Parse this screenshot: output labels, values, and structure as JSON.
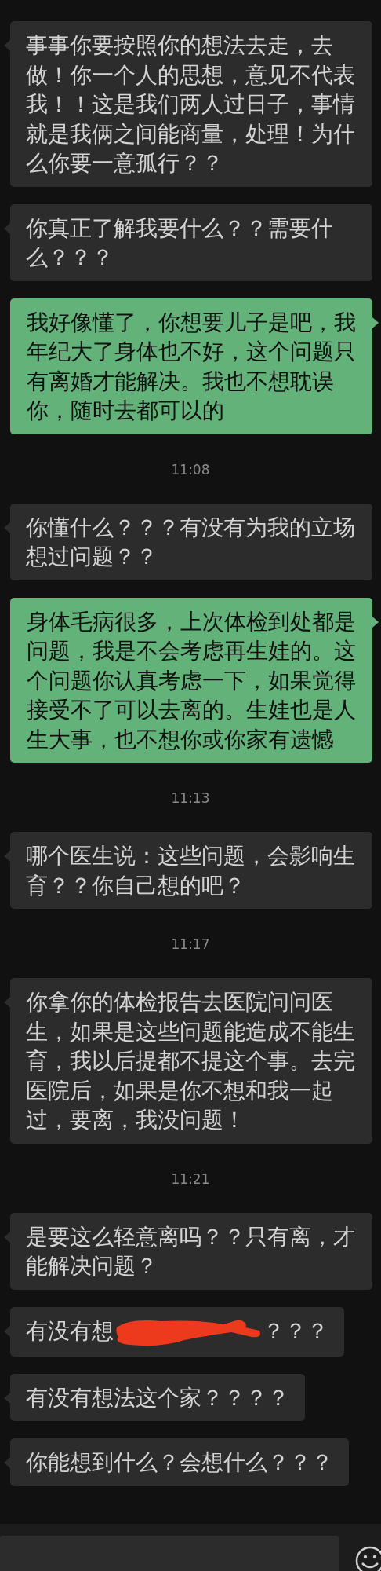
{
  "messages": [
    {
      "kind": "received",
      "text": "事事你要按照你的想法去走，去做！你一个人的思想，意见不代表我！！这是我们两人过日子，事情就是我俩之间能商量，处理！为什么你要一意孤行？？"
    },
    {
      "kind": "received",
      "text": "你真正了解我要什么？？需要什么？？？"
    },
    {
      "kind": "sent",
      "text": "我好像懂了，你想要儿子是吧，我年纪大了身体也不好，这个问题只有离婚才能解决。我也不想耽误你，随时去都可以的"
    },
    {
      "kind": "time",
      "text": "11:08"
    },
    {
      "kind": "received",
      "text": "你懂什么？？？有没有为我的立场想过问题？？"
    },
    {
      "kind": "sent",
      "text": "身体毛病很多，上次体检到处都是问题，我是不会考虑再生娃的。这个问题你认真考虑一下，如果觉得接受不了可以去离的。生娃也是人生大事，也不想你或你家有遗憾"
    },
    {
      "kind": "time",
      "text": "11:13"
    },
    {
      "kind": "received",
      "text": "哪个医生说：这些问题，会影响生育？？你自己想的吧？"
    },
    {
      "kind": "time",
      "text": "11:17"
    },
    {
      "kind": "received",
      "text": "你拿你的体检报告去医院问问医生，如果是这些问题能造成不能生育，我以后提都不提这个事。去完医院后，如果是你不想和我一起过，要离，我没问题！"
    },
    {
      "kind": "time",
      "text": "11:21"
    },
    {
      "kind": "received",
      "text": "是要这么轻意离吗？？只有离，才能解决问题？"
    },
    {
      "kind": "received",
      "text": "有没有想",
      "redacted": true,
      "text_after": "？？？"
    },
    {
      "kind": "received",
      "text": "有没有想法这个家？？？？"
    },
    {
      "kind": "received",
      "text": "你能想到什么？会想什么？？？"
    }
  ]
}
